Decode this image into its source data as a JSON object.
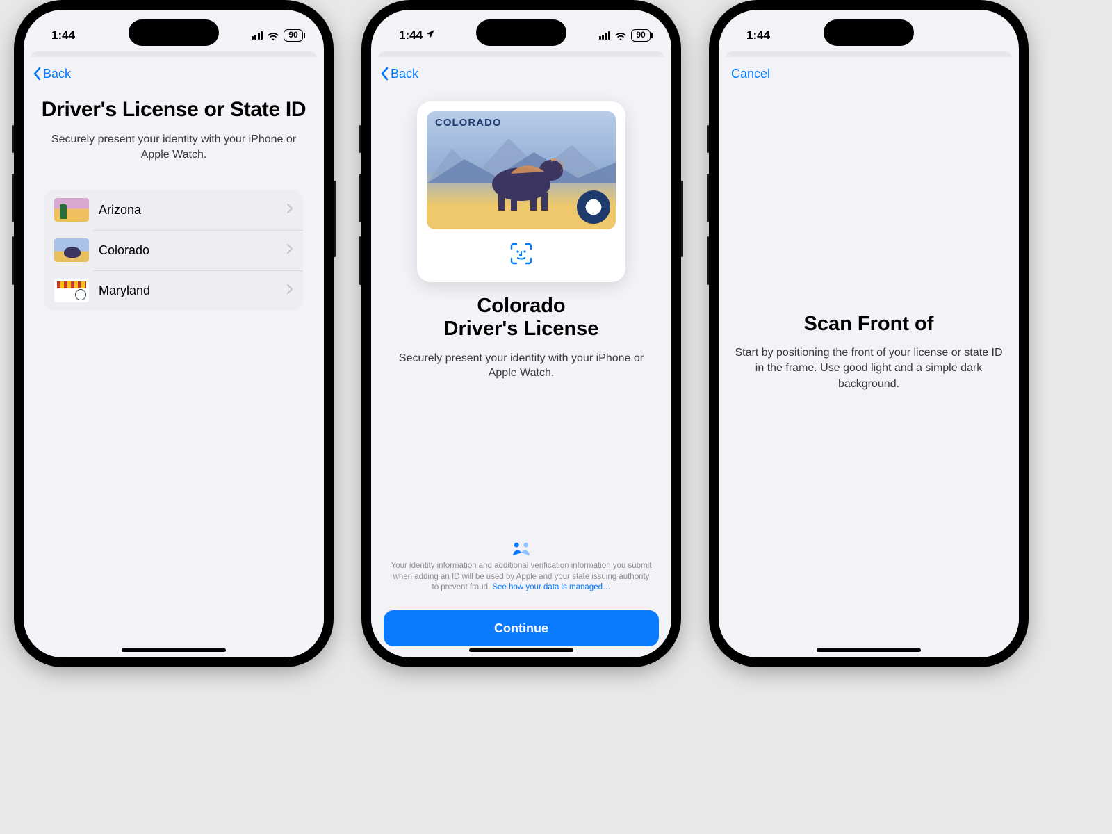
{
  "status": {
    "time": "1:44",
    "battery": "90"
  },
  "screen1": {
    "back_label": "Back",
    "title": "Driver's License or State ID",
    "subtitle": "Securely present your identity with your iPhone or Apple Watch.",
    "states": [
      {
        "label": "Arizona"
      },
      {
        "label": "Colorado"
      },
      {
        "label": "Maryland"
      }
    ]
  },
  "screen2": {
    "back_label": "Back",
    "card_state_label": "COLORADO",
    "title_line1": "Colorado",
    "title_line2": "Driver's License",
    "subtitle": "Securely present your identity with your iPhone or Apple Watch.",
    "privacy_text": "Your identity information and additional verification information you submit when adding an ID will be used by Apple and your state issuing authority to prevent fraud. ",
    "privacy_link": "See how your data is managed…",
    "continue_label": "Continue"
  },
  "screen3": {
    "cancel_label": "Cancel",
    "title": "Scan Front of",
    "body": "Start by positioning the front of your license or state ID in the frame. Use good light and a simple dark background."
  }
}
